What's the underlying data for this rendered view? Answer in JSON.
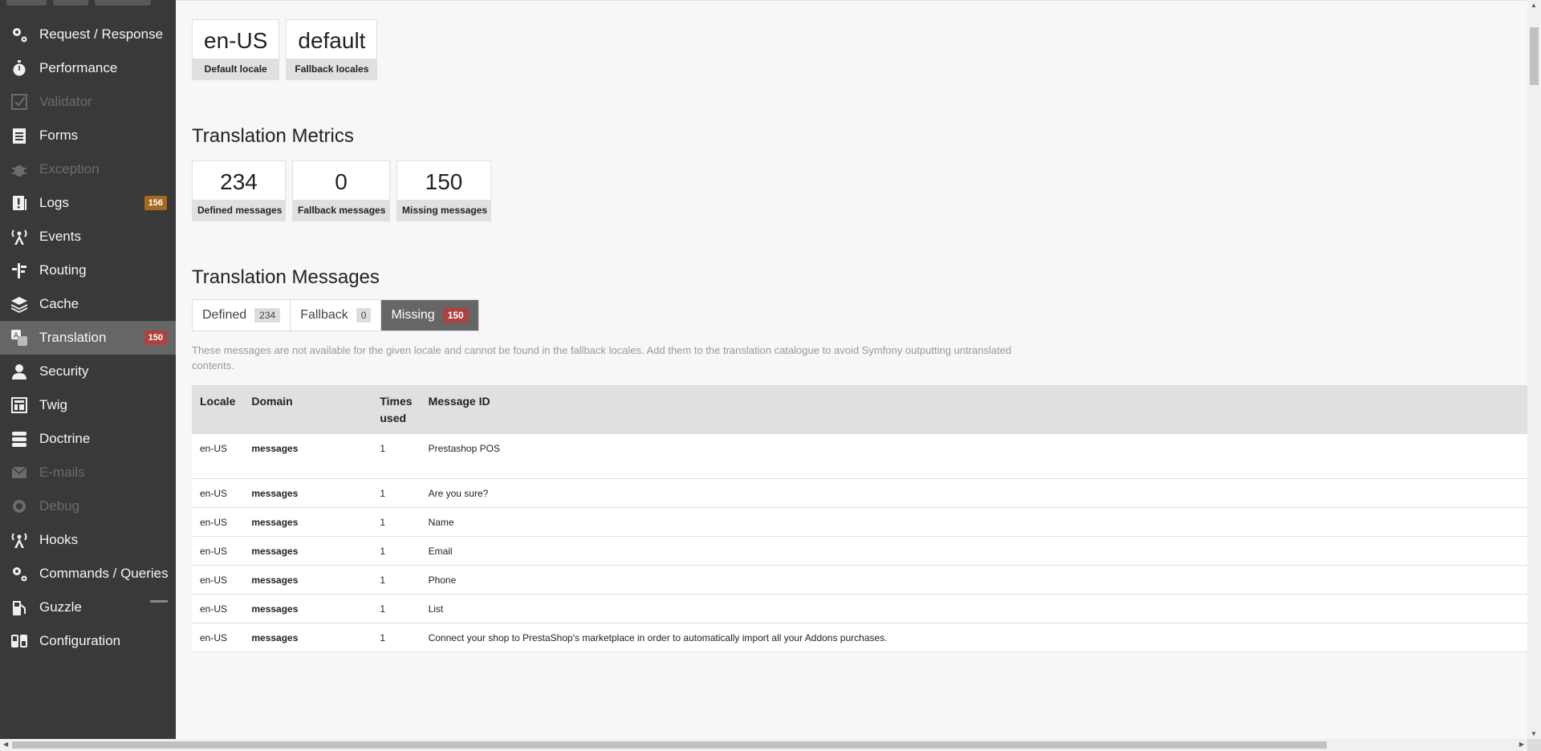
{
  "sidebar": {
    "items": [
      {
        "label": "Request / Response",
        "icon": "gears-icon",
        "disabled": false
      },
      {
        "label": "Performance",
        "icon": "stopwatch-icon",
        "disabled": false
      },
      {
        "label": "Validator",
        "icon": "checkbox-icon",
        "disabled": true
      },
      {
        "label": "Forms",
        "icon": "form-icon",
        "disabled": false
      },
      {
        "label": "Exception",
        "icon": "bug-icon",
        "disabled": true
      },
      {
        "label": "Logs",
        "icon": "log-icon",
        "disabled": false,
        "count": "156",
        "count_level": "warn"
      },
      {
        "label": "Events",
        "icon": "antenna-icon",
        "disabled": false
      },
      {
        "label": "Routing",
        "icon": "route-icon",
        "disabled": false
      },
      {
        "label": "Cache",
        "icon": "layers-icon",
        "disabled": false
      },
      {
        "label": "Translation",
        "icon": "translate-icon",
        "disabled": false,
        "active": true,
        "count": "150",
        "count_level": "err"
      },
      {
        "label": "Security",
        "icon": "user-icon",
        "disabled": false
      },
      {
        "label": "Twig",
        "icon": "template-icon",
        "disabled": false
      },
      {
        "label": "Doctrine",
        "icon": "database-icon",
        "disabled": false
      },
      {
        "label": "E-mails",
        "icon": "envelope-icon",
        "disabled": true
      },
      {
        "label": "Debug",
        "icon": "crosshair-icon",
        "disabled": true
      },
      {
        "label": "Hooks",
        "icon": "antenna-icon",
        "disabled": false
      },
      {
        "label": "Commands / Queries",
        "icon": "gears-icon",
        "disabled": false
      },
      {
        "label": "Guzzle",
        "icon": "fuel-icon",
        "disabled": false,
        "dash": true
      },
      {
        "label": "Configuration",
        "icon": "toggle-icon",
        "disabled": false
      }
    ]
  },
  "locales": {
    "default_value": "en-US",
    "default_label": "Default locale",
    "fallback_value": "default",
    "fallback_label": "Fallback locales"
  },
  "metrics": {
    "title": "Translation Metrics",
    "defined_value": "234",
    "defined_label": "Defined messages",
    "fallback_value": "0",
    "fallback_label": "Fallback messages",
    "missing_value": "150",
    "missing_label": "Missing messages"
  },
  "messages": {
    "title": "Translation Messages",
    "tabs": [
      {
        "label": "Defined",
        "badge": "234"
      },
      {
        "label": "Fallback",
        "badge": "0"
      },
      {
        "label": "Missing",
        "badge": "150",
        "active": true
      }
    ],
    "help": "These messages are not available for the given locale and cannot be found in the fallback locales. Add them to the translation catalogue to avoid Symfony outputting untranslated contents.",
    "columns": {
      "locale": "Locale",
      "domain": "Domain",
      "times_used": "Times used",
      "message_id": "Message ID"
    },
    "rows": [
      {
        "locale": "en-US",
        "domain": "messages",
        "times": "1",
        "id": "Prestashop POS"
      },
      {
        "locale": "en-US",
        "domain": "messages",
        "times": "1",
        "id": "Are you sure?"
      },
      {
        "locale": "en-US",
        "domain": "messages",
        "times": "1",
        "id": "Name"
      },
      {
        "locale": "en-US",
        "domain": "messages",
        "times": "1",
        "id": "Email"
      },
      {
        "locale": "en-US",
        "domain": "messages",
        "times": "1",
        "id": "Phone"
      },
      {
        "locale": "en-US",
        "domain": "messages",
        "times": "1",
        "id": "List"
      },
      {
        "locale": "en-US",
        "domain": "messages",
        "times": "1",
        "id": "Connect your shop to PrestaShop's marketplace in order to automatically import all your Addons purchases."
      }
    ]
  }
}
